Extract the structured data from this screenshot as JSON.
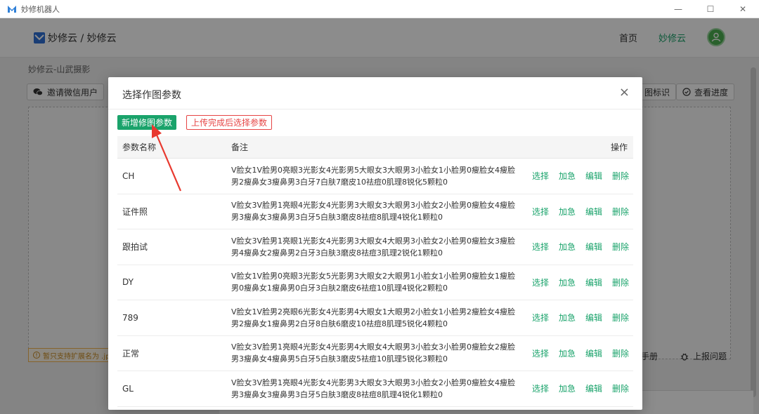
{
  "window": {
    "title": "妙修机器人",
    "controls": [
      "—",
      "☐",
      "✕"
    ]
  },
  "header": {
    "brand": "妙修云 / 妙修云",
    "nav": [
      {
        "label": "首页"
      },
      {
        "label": "妙修云"
      }
    ]
  },
  "page": {
    "breadcrumb": "妙修云-山武摄影",
    "invite_label": "邀请微信用户",
    "right_buttons": [
      {
        "label": "图标识"
      },
      {
        "label": "查看进度"
      }
    ],
    "notice": "暂只支持扩展名为 .jp",
    "manual_label": "手册",
    "report_label": "上报问题"
  },
  "modal": {
    "title": "选择作图参数",
    "close": "×",
    "add_label": "新增修图参数",
    "upload_label": "上传完成后选择参数",
    "columns": {
      "name": "参数名称",
      "note": "备注",
      "ops": "操作"
    },
    "ops": {
      "select": "选择",
      "urgent": "加急",
      "edit": "编辑",
      "delete": "删除"
    },
    "rows": [
      {
        "name": "CH",
        "note": "V脸女1V脸男0亮眼3光影女4光影男5大眼女3大眼男3小脸女1小脸男0瘦脸女4瘦脸男2瘦鼻女3瘦鼻男3白牙7白肤7磨皮10祛痘0肌理8锐化5颗粒0"
      },
      {
        "name": "证件照",
        "note": "V脸女3V脸男1亮眼4光影女4光影男3大眼女3大眼男3小脸女2小脸男0瘦脸女4瘦脸男3瘦鼻女3瘦鼻男3白牙5白肤3磨皮8祛痘8肌理4锐化1颗粒0"
      },
      {
        "name": "跟拍试",
        "note": "V脸女3V脸男1亮眼1光影女4光影男3大眼女4大眼男3小脸女2小脸男0瘦脸女3瘦脸男4瘦鼻女2瘦鼻男2白牙3白肤3磨皮8祛痘3肌理2锐化1颗粒0"
      },
      {
        "name": "DY",
        "note": "V脸女1V脸男0亮眼3光影女5光影男3大眼女2大眼男1小脸女1小脸男0瘦脸女1瘦脸男0瘦鼻女1瘦鼻男0白牙3白肤2磨皮6祛痘10肌理4锐化2颗粒0"
      },
      {
        "name": "789",
        "note": "V脸女1V脸男2亮眼6光影女4光影男4大眼女1大眼男2小脸女1小脸男2瘦脸女4瘦脸男2瘦鼻女1瘦鼻男2白牙8白肤6磨皮10祛痘8肌理5锐化4颗粒0"
      },
      {
        "name": "正常",
        "note": "V脸女3V脸男1亮眼4光影女4光影男4大眼女4大眼男3小脸女3小脸男0瘦脸女2瘦脸男3瘦鼻女4瘦鼻男5白牙5白肤3磨皮5祛痘10肌理5锐化3颗粒0"
      },
      {
        "name": "GL",
        "note": "V脸女3V脸男1亮眼4光影女4光影男3大眼女3大眼男3小脸女2小脸男0瘦脸女4瘦脸男3瘦鼻女3瘦鼻男3白牙5白肤3磨皮8祛痘8肌理4锐化1颗粒0"
      }
    ]
  },
  "colors": {
    "primary": "#1aa36b",
    "danger": "#e64545",
    "annotation": "#e8392f"
  }
}
